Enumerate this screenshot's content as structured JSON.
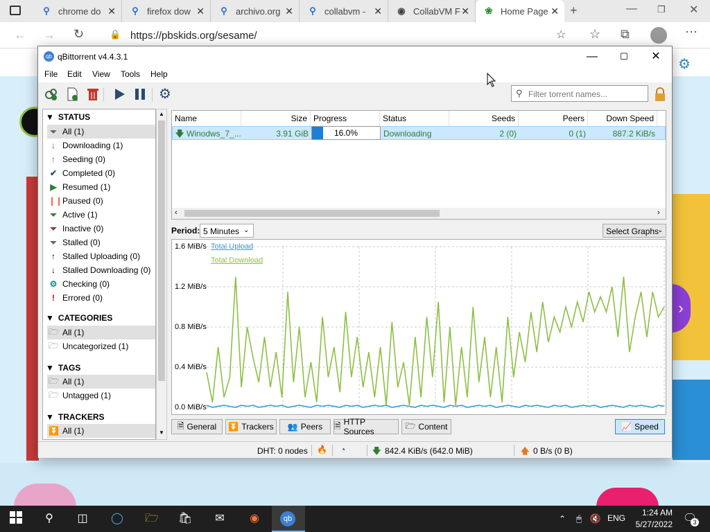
{
  "browser": {
    "tabs": [
      {
        "label": "chrome do",
        "icon": "search-icon"
      },
      {
        "label": "firefox dow",
        "icon": "search-icon"
      },
      {
        "label": "archivo.org",
        "icon": "search-icon"
      },
      {
        "label": "collabvm -",
        "icon": "search-icon"
      },
      {
        "label": "CollabVM F",
        "icon": "collabvm-icon"
      },
      {
        "label": "Home Page",
        "icon": "sesame-icon"
      }
    ],
    "url": "https://pbskids.org/sesame/"
  },
  "qb": {
    "title": "qBittorrent v4.4.3.1",
    "menu": [
      "File",
      "Edit",
      "View",
      "Tools",
      "Help"
    ],
    "filter_placeholder": "Filter torrent names...",
    "sections": {
      "status": {
        "title": "STATUS",
        "items": [
          {
            "label": "All (1)",
            "icon": "filter-icon",
            "color": "#666666"
          },
          {
            "label": "Downloading (1)",
            "icon": "arrow-down-icon",
            "color": "#2e7d32"
          },
          {
            "label": "Seeding (0)",
            "icon": "arrow-up-icon",
            "color": "#3a5bd9"
          },
          {
            "label": "Completed (0)",
            "icon": "check-icon",
            "color": "#2b4a6f"
          },
          {
            "label": "Resumed (1)",
            "icon": "play-icon",
            "color": "#2e7d32"
          },
          {
            "label": "Paused (0)",
            "icon": "pause-icon",
            "color": "#f07860"
          },
          {
            "label": "Active (1)",
            "icon": "filter-icon",
            "color": "#2e7d32"
          },
          {
            "label": "Inactive (0)",
            "icon": "filter-icon",
            "color": "#8a3a3a"
          },
          {
            "label": "Stalled (0)",
            "icon": "filter-icon",
            "color": "#666666"
          },
          {
            "label": "Stalled Uploading (0)",
            "icon": "arrow-up-icon",
            "color": "#000000"
          },
          {
            "label": "Stalled Downloading (0)",
            "icon": "arrow-down-icon",
            "color": "#000000"
          },
          {
            "label": "Checking (0)",
            "icon": "gear-icon",
            "color": "#1a8a8a"
          },
          {
            "label": "Errored (0)",
            "icon": "exclamation-icon",
            "color": "#d00000"
          }
        ]
      },
      "categories": {
        "title": "CATEGORIES",
        "items": [
          "All (1)",
          "Uncategorized (1)"
        ]
      },
      "tags": {
        "title": "TAGS",
        "items": [
          "All (1)",
          "Untagged (1)"
        ]
      },
      "trackers": {
        "title": "TRACKERS",
        "items": [
          "All (1)"
        ]
      }
    },
    "columns": [
      "Name",
      "Size",
      "Progress",
      "Status",
      "Seeds",
      "Peers",
      "Down Speed"
    ],
    "torrent": {
      "name": "Winodws_7_...",
      "size": "3.91 GiB",
      "progress": 0.16,
      "progress_text": "16.0%",
      "status": "Downloading",
      "seeds": "2 (0)",
      "peers": "0 (1)",
      "down_speed": "887.2 KiB/s"
    },
    "period_label": "Period:",
    "period_value": "5 Minutes",
    "select_graphs": "Select Graphs",
    "bottom_tabs": [
      "General",
      "Trackers",
      "Peers",
      "HTTP Sources",
      "Content"
    ],
    "speed_tab": "Speed",
    "statusbar": {
      "dht": "DHT: 0 nodes",
      "down": "842.4 KiB/s (642.0 MiB)",
      "up": "0 B/s (0 B)"
    }
  },
  "taskbar": {
    "lang": "ENG",
    "time": "1:24 AM",
    "date": "5/27/2022",
    "notifications": "3"
  },
  "colors": {
    "upload": "#3d9ad1",
    "download": "#8dbf45",
    "accent": "#0078d7"
  },
  "chart_data": {
    "type": "line",
    "title": "",
    "xlabel": "",
    "ylabel": "",
    "yticks": [
      "1.6 MiB/s",
      "1.2 MiB/s",
      "0.8 MiB/s",
      "0.4 MiB/s",
      "0.0 MiB/s"
    ],
    "ylim": [
      0,
      1.6
    ],
    "grid": true,
    "legend": "top-left",
    "series": [
      {
        "name": "Total Upload",
        "color": "#3d9ad1",
        "values": [
          0.02,
          0.0,
          0.01,
          0.02,
          0.01,
          0.0,
          0.02,
          0.01,
          0.02,
          0.0,
          0.01,
          0.02,
          0.01,
          0.02,
          0.0,
          0.01,
          0.02,
          0.01,
          0.0,
          0.02,
          0.01,
          0.02,
          0.01,
          0.0,
          0.02,
          0.01,
          0.02,
          0.0,
          0.01,
          0.02,
          0.01,
          0.02,
          0.0,
          0.01,
          0.02,
          0.01,
          0.0,
          0.02,
          0.01,
          0.02,
          0.01,
          0.0,
          0.02,
          0.01,
          0.02,
          0.0,
          0.01,
          0.02,
          0.01,
          0.02,
          0.0,
          0.01,
          0.02,
          0.01,
          0.0,
          0.02,
          0.01,
          0.02,
          0.01,
          0.0,
          0.02,
          0.01,
          0.02,
          0.0,
          0.01,
          0.02,
          0.01,
          0.02,
          0.0,
          0.01,
          0.02,
          0.01,
          0.0,
          0.02,
          0.01,
          0.02,
          0.01,
          0.0,
          0.02,
          0.01
        ]
      },
      {
        "name": "Total Download",
        "color": "#8dbf45",
        "values": [
          0.35,
          0.05,
          0.6,
          0.1,
          0.3,
          1.3,
          0.2,
          0.8,
          0.5,
          0.25,
          0.7,
          0.2,
          0.55,
          0.1,
          1.15,
          0.25,
          0.8,
          0.1,
          0.45,
          0.05,
          0.9,
          0.3,
          0.6,
          0.15,
          0.95,
          0.3,
          0.7,
          0.2,
          0.55,
          0.1,
          0.6,
          0.02,
          0.85,
          0.2,
          0.45,
          0.02,
          0.7,
          0.1,
          0.9,
          0.3,
          1.05,
          0.05,
          0.8,
          0.02,
          0.6,
          0.1,
          1.0,
          0.25,
          0.7,
          0.1,
          0.6,
          0.05,
          0.9,
          0.3,
          0.75,
          0.45,
          0.95,
          0.55,
          1.05,
          0.65,
          0.9,
          0.75,
          1.0,
          0.8,
          1.05,
          0.85,
          1.15,
          0.95,
          1.1,
          0.95,
          1.2,
          0.7,
          1.3,
          0.55,
          0.9,
          1.15,
          0.7,
          1.15,
          0.9,
          1.0
        ]
      }
    ]
  }
}
